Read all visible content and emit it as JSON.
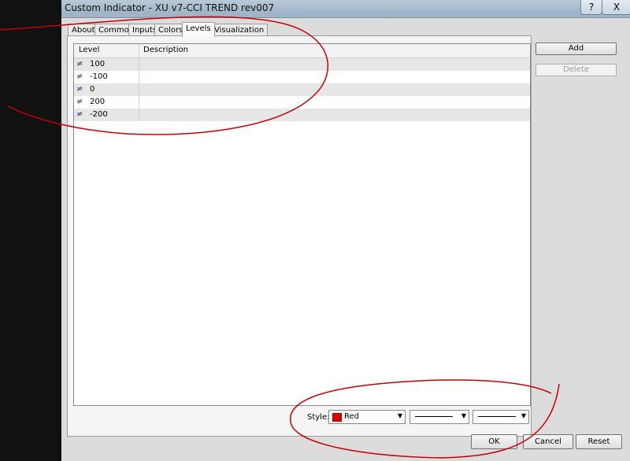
{
  "window": {
    "title": "Custom Indicator - XU v7-CCI TREND rev007",
    "help": "?",
    "close": "X"
  },
  "tabs": [
    "About",
    "Common",
    "Inputs",
    "Colors",
    "Levels",
    "Visualization"
  ],
  "active_tab": "Levels",
  "levels_table": {
    "headers": {
      "level": "Level",
      "description": "Description"
    },
    "rows": [
      {
        "level": "100",
        "description": ""
      },
      {
        "level": "-100",
        "description": ""
      },
      {
        "level": "0",
        "description": ""
      },
      {
        "level": "200",
        "description": ""
      },
      {
        "level": "-200",
        "description": ""
      }
    ]
  },
  "side_buttons": {
    "add": "Add",
    "delete": "Delete"
  },
  "style": {
    "label": "Style:",
    "color_name": "Red",
    "color_hex": "#e00000"
  },
  "footer": {
    "ok": "OK",
    "cancel": "Cancel",
    "reset": "Reset"
  }
}
